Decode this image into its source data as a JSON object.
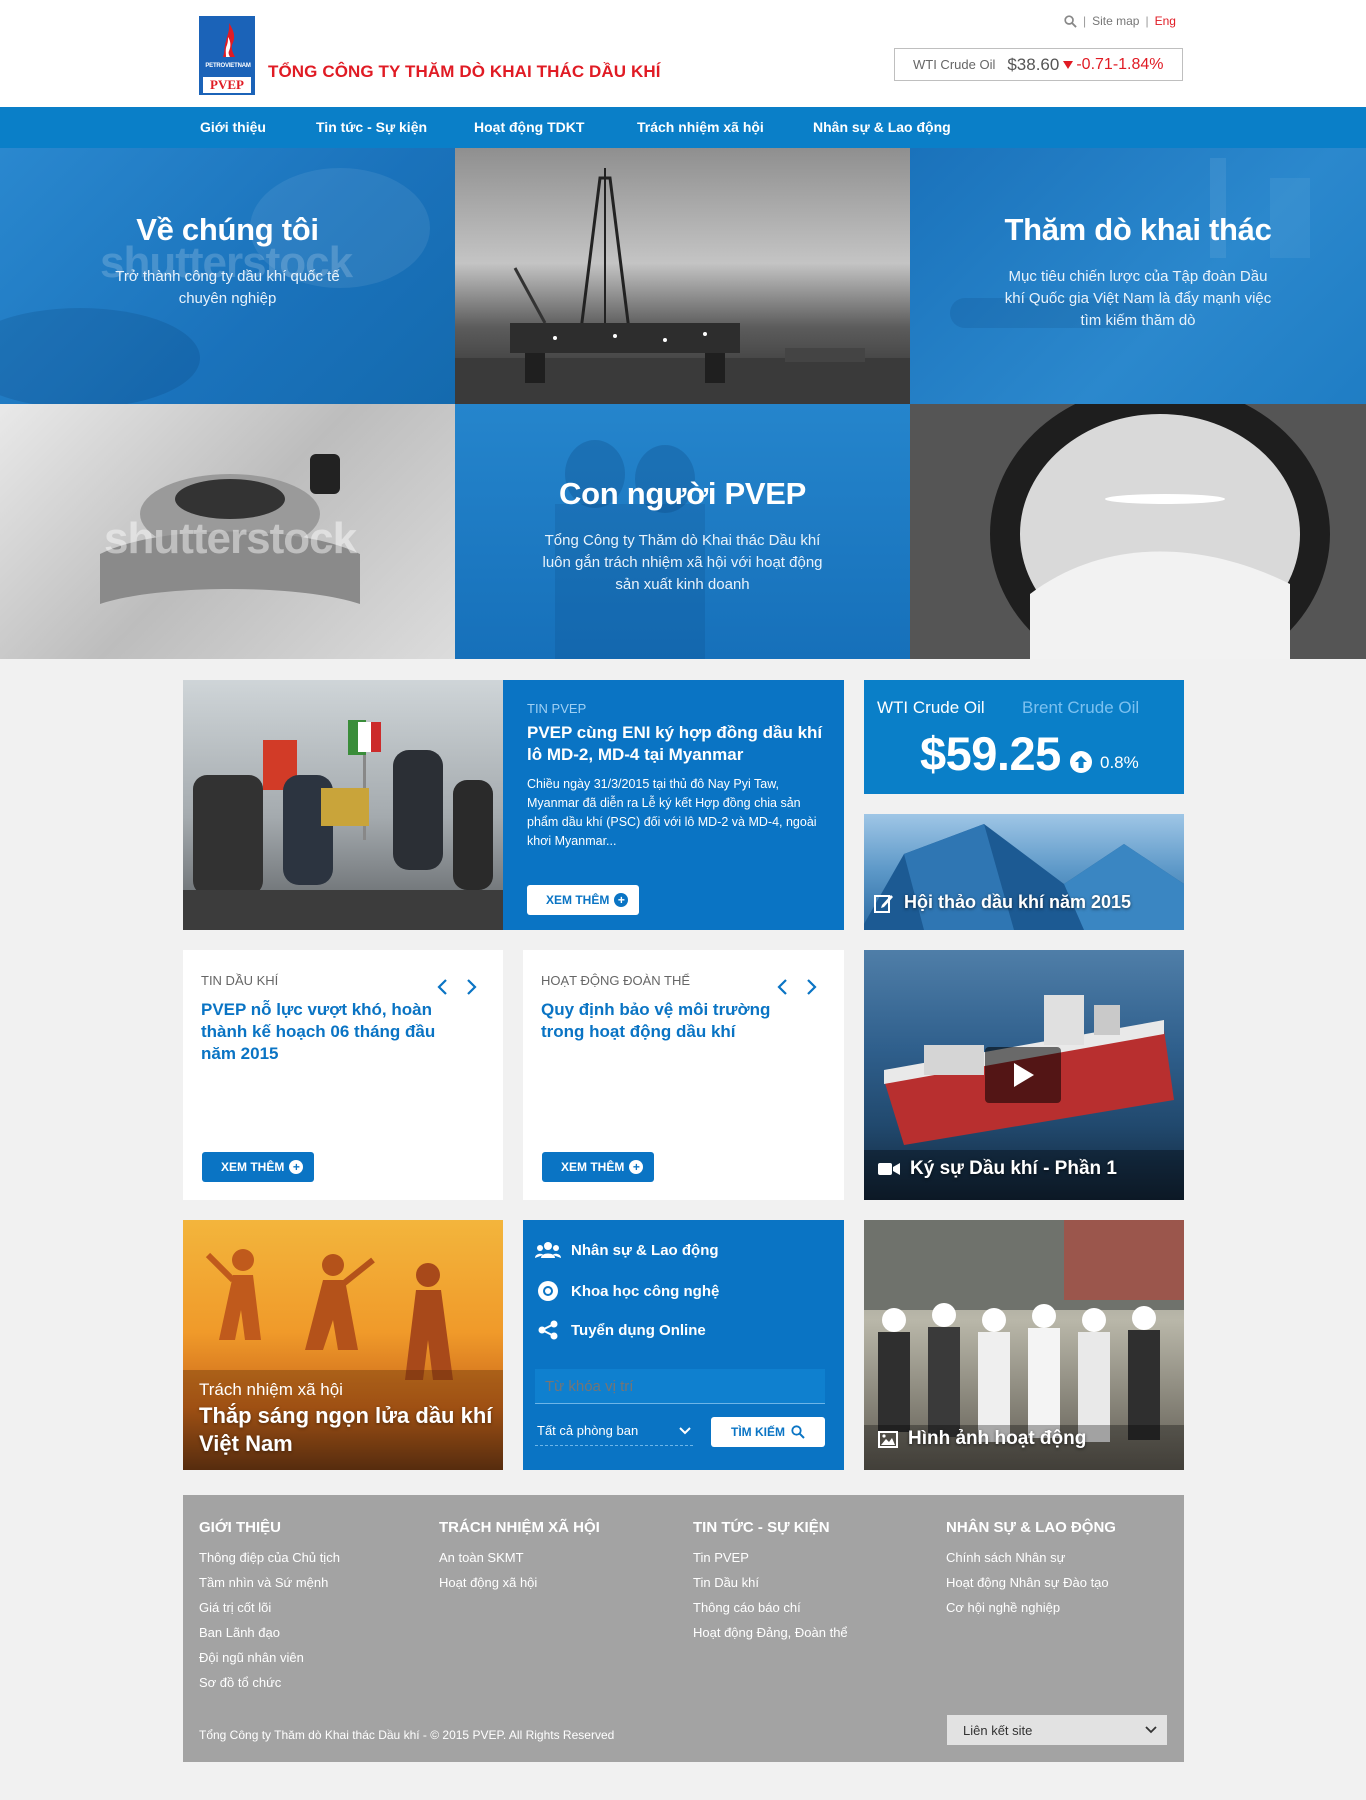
{
  "header": {
    "logo": {
      "small_text": "PETROVIETNAM",
      "brand": "PVEP"
    },
    "company_name": "TỔNG CÔNG TY THĂM DÒ KHAI THÁC DẦU KHÍ",
    "sep1": "|",
    "site_map": "Site map",
    "sep2": "|",
    "lang": "Eng",
    "ticker": {
      "label": "WTI Crude Oil",
      "price": "$38.60",
      "change": "-0.71-1.84%"
    }
  },
  "nav": {
    "items": [
      "Giới thiệu",
      "Tin tức - Sự kiện",
      "Hoạt động TDKT",
      "Trách nhiệm xã hội",
      "Nhân sự & Lao động"
    ]
  },
  "hero": {
    "about": {
      "title": "Về chúng tôi",
      "line1": "Trở thành công ty dầu khí quốc tế",
      "line2": "chuyên nghiệp"
    },
    "explore": {
      "title": "Thăm dò khai thác",
      "line1": "Mục tiêu chiến lược của Tập đoàn Dầu",
      "line2": "khí Quốc gia Việt Nam là đẩy mạnh việc",
      "line3": "tìm kiếm thăm dò"
    },
    "people": {
      "title": "Con người PVEP",
      "line1": "Tổng Công ty Thăm dò Khai thác Dầu khí",
      "line2": "luôn gắn trách nhiệm xã hội với hoạt động",
      "line3": "sản xuất kinh doanh"
    },
    "watermark": "shutterstock"
  },
  "featured": {
    "category": "TIN PVEP",
    "title": "PVEP cùng ENI ký hợp đồng dầu khí lô MD-2, MD-4 tại Myanmar",
    "summary": "Chiều ngày 31/3/2015 tại thủ đô Nay Pyi Taw, Myanmar đã diễn ra Lễ ký kết Hợp đồng chia sản phẩm dầu khí (PSC) đối với lô MD-2 và MD-4, ngoài khơi Myanmar...",
    "button": "XEM THÊM"
  },
  "oil_widget": {
    "tab_active": "WTI Crude Oil",
    "tab_inactive": "Brent Crude Oil",
    "price": "$59.25",
    "change": "0.8%"
  },
  "seminar": {
    "caption": "Hội thảo dầu khí năm 2015"
  },
  "news_oil": {
    "category": "TIN DẦU KHÍ",
    "title": "PVEP nỗ lực vượt khó, hoàn thành kế hoạch 06 tháng đầu năm 2015",
    "button": "XEM THÊM"
  },
  "news_union": {
    "category": "HOẠT ĐỘNG ĐOÀN THỂ",
    "title": "Quy định bảo vệ môi trường trong hoạt động dầu khí",
    "button": "XEM THÊM"
  },
  "video": {
    "caption": "Ký sự Dầu khí - Phần 1"
  },
  "csr": {
    "label": "Trách nhiệm xã hội",
    "title_line1": "Thắp sáng ngọn lửa dầu khí",
    "title_line2": "Việt Nam"
  },
  "quicklinks": {
    "items": [
      "Nhân sự & Lao động",
      "Khoa học công nghệ",
      "Tuyển dụng Online"
    ],
    "search_placeholder": "Từ khóa vị trí",
    "department": "Tất cả phòng ban",
    "search_button": "TÌM KIẾM"
  },
  "gallery": {
    "caption": "Hình ảnh hoạt động"
  },
  "footer": {
    "col1": {
      "title": "GIỚI THIỆU",
      "links": [
        "Thông điệp của Chủ tịch",
        "Tầm nhìn và Sứ mệnh",
        "Giá trị cốt lõi",
        "Ban Lãnh đạo",
        "Đội ngũ nhân viên",
        "Sơ đồ tổ chức"
      ]
    },
    "col2": {
      "title": "TRÁCH NHIỆM XÃ HỘI",
      "links": [
        "An toàn SKMT",
        "Hoạt động xã hội"
      ]
    },
    "col3": {
      "title": "TIN TỨC - SỰ KIỆN",
      "links": [
        "Tin PVEP",
        "Tin Dầu khí",
        "Thông cáo báo chí",
        "Hoạt động Đảng, Đoàn thể"
      ]
    },
    "col4": {
      "title": "NHÂN SỰ & LAO ĐỘNG",
      "links": [
        "Chính sách Nhân sự",
        "Hoạt động Nhân sự Đào tạo",
        "Cơ hội nghề nghiệp"
      ]
    },
    "copyright": "Tổng Công ty Thăm dò Khai thác Dầu khí - © 2015 PVEP. All Rights Reserved",
    "site_link": "Liên kết site"
  },
  "colors": {
    "primary_blue": "#0a7fc8",
    "brand_red": "#e01b24",
    "footer_gray": "#a3a3a3"
  }
}
